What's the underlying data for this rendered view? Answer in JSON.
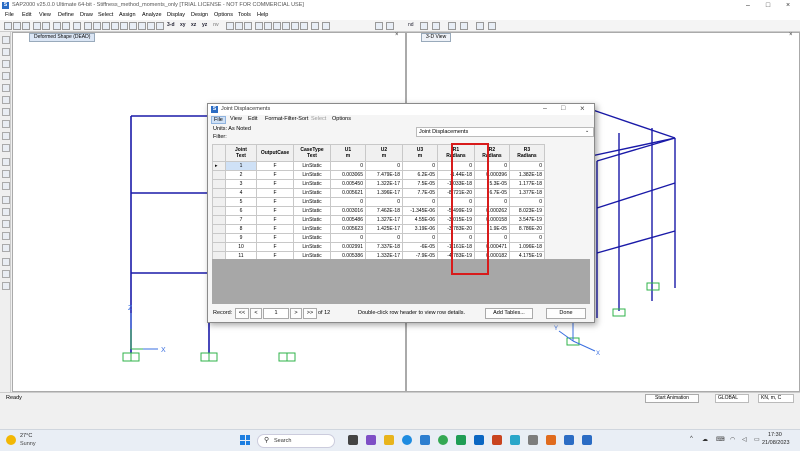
{
  "app": {
    "title": "SAP2000 v25.0.0 Ultimate 64-bit - Stiffness_method_moments_only [TRIAL LICENSE - NOT FOR COMMERCIAL USE]",
    "logo_letter": "S",
    "accent": "#2b6cc4"
  },
  "menu": [
    "File",
    "Edit",
    "View",
    "Define",
    "Draw",
    "Select",
    "Assign",
    "Analyze",
    "Display",
    "Design",
    "Options",
    "Tools",
    "Help"
  ],
  "toolbar": {
    "plane_labels": [
      "3-d",
      "xy",
      "xz",
      "yz",
      "nv"
    ],
    "units_value": "nd"
  },
  "viewports": {
    "left_tab": "Deformed Shape (DEAD)",
    "right_tab": "3-D View",
    "axis_x": "X",
    "axis_z": "Z",
    "axis_y": "Y"
  },
  "dialog": {
    "title": "Joint Displacements",
    "logo_letter": "S",
    "menu": [
      "File",
      "View",
      "Edit",
      "Format-Filter-Sort",
      "Select",
      "Options"
    ],
    "units_label": "Units:  As Noted",
    "filter_label": "Filter:",
    "table_select": "Joint Displacements",
    "columns": [
      {
        "name": "Joint",
        "unit": "Text"
      },
      {
        "name": "OutputCase",
        "unit": ""
      },
      {
        "name": "CaseType",
        "unit": "Text"
      },
      {
        "name": "U1",
        "unit": "m"
      },
      {
        "name": "U2",
        "unit": "m"
      },
      {
        "name": "U3",
        "unit": "m"
      },
      {
        "name": "R1",
        "unit": "Radians"
      },
      {
        "name": "R2",
        "unit": "Radians"
      },
      {
        "name": "R3",
        "unit": "Radians"
      }
    ],
    "rows": [
      [
        "1",
        "F",
        "LinStatic",
        "0",
        "0",
        "0",
        "0",
        "0",
        "0"
      ],
      [
        "2",
        "F",
        "LinStatic",
        "0.003065",
        "7.479E-18",
        "6.2E-05",
        "-1.44E-18",
        "0.000396",
        "1.382E-18"
      ],
      [
        "3",
        "F",
        "LinStatic",
        "0.005450",
        "1.322E-17",
        "7.5E-05",
        "-1.033E-18",
        "5.3E-05",
        "1.177E-18"
      ],
      [
        "4",
        "F",
        "LinStatic",
        "0.005621",
        "1.396E-17",
        "7.7E-05",
        "-8.721E-20",
        "6.7E-05",
        "1.377E-18"
      ],
      [
        "5",
        "F",
        "LinStatic",
        "0",
        "0",
        "0",
        "0",
        "0",
        "0"
      ],
      [
        "6",
        "F",
        "LinStatic",
        "0.003016",
        "7.462E-18",
        "-1.345E-06",
        "-5.499E-19",
        "0.000262",
        "8.023E-19"
      ],
      [
        "7",
        "F",
        "LinStatic",
        "0.005486",
        "1.327E-17",
        "4.55E-06",
        "-3.015E-19",
        "0.000158",
        "3.547E-19"
      ],
      [
        "8",
        "F",
        "LinStatic",
        "0.005623",
        "1.425E-17",
        "3.19E-06",
        "-3.783E-20",
        "1.9E-05",
        "8.786E-20"
      ],
      [
        "9",
        "F",
        "LinStatic",
        "0",
        "0",
        "0",
        "0",
        "0",
        "0"
      ],
      [
        "10",
        "F",
        "LinStatic",
        "0.002991",
        "7.337E-18",
        "-6E-05",
        "-1.161E-18",
        "0.000471",
        "1.096E-18"
      ],
      [
        "11",
        "F",
        "LinStatic",
        "0.005386",
        "1.332E-17",
        "-7.9E-05",
        "-4.783E-19",
        "0.000182",
        "4.175E-19"
      ],
      [
        "12",
        "F",
        "LinStatic",
        "0.005625",
        "1.457E-17",
        "-8E-05",
        "-1.054E-19",
        "2.8E-05",
        "9.256E-20"
      ]
    ],
    "record_label": "Record:",
    "record_value": "1",
    "record_of": "of 12",
    "nav_first": "<<",
    "nav_prev": "<",
    "nav_next": ">",
    "nav_last": ">>",
    "hint": "Double-click row header to view row details.",
    "add_tables": "Add Tables...",
    "done": "Done",
    "highlight_color": "#d81b1b"
  },
  "statusbar": {
    "left": "Ready",
    "start_animation": "Start Animation",
    "global": "GLOBAL",
    "units": "KN, m, C"
  },
  "taskbar": {
    "weather_temp": "27°C",
    "weather_text": "Sunny",
    "search": "Search",
    "time": "17:30",
    "date": "21/08/2023"
  }
}
